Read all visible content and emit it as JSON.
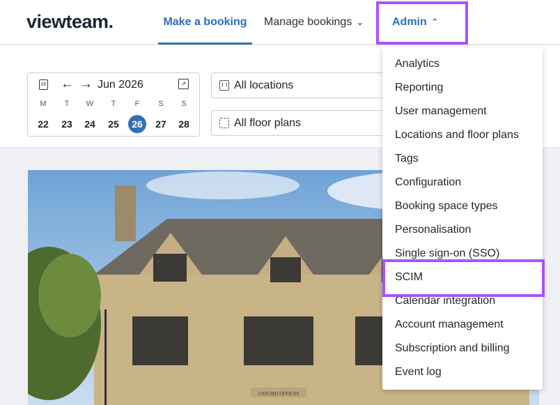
{
  "header": {
    "logo": "viewteam.",
    "nav": {
      "make_booking": "Make a booking",
      "manage_bookings": "Manage bookings",
      "admin": "Admin"
    }
  },
  "datepicker": {
    "calendar_icon_text": "26",
    "month": "Jun 2026",
    "weekdays": [
      "M",
      "T",
      "W",
      "T",
      "F",
      "S",
      "S"
    ],
    "dates": [
      "22",
      "23",
      "24",
      "25",
      "26",
      "27",
      "28"
    ],
    "selected_date": "26"
  },
  "filters": {
    "location": "All locations",
    "floor_plan": "All floor plans"
  },
  "hero": {
    "sign_text": "OXFORD OFFICES"
  },
  "admin_menu": {
    "items": [
      "Analytics",
      "Reporting",
      "User management",
      "Locations and floor plans",
      "Tags",
      "Configuration",
      "Booking space types",
      "Personalisation",
      "Single sign-on (SSO)",
      "SCIM",
      "Calendar integration",
      "Account management",
      "Subscription and billing",
      "Event log"
    ]
  },
  "colors": {
    "accent": "#2f6fb5",
    "highlight": "#a855f7"
  }
}
